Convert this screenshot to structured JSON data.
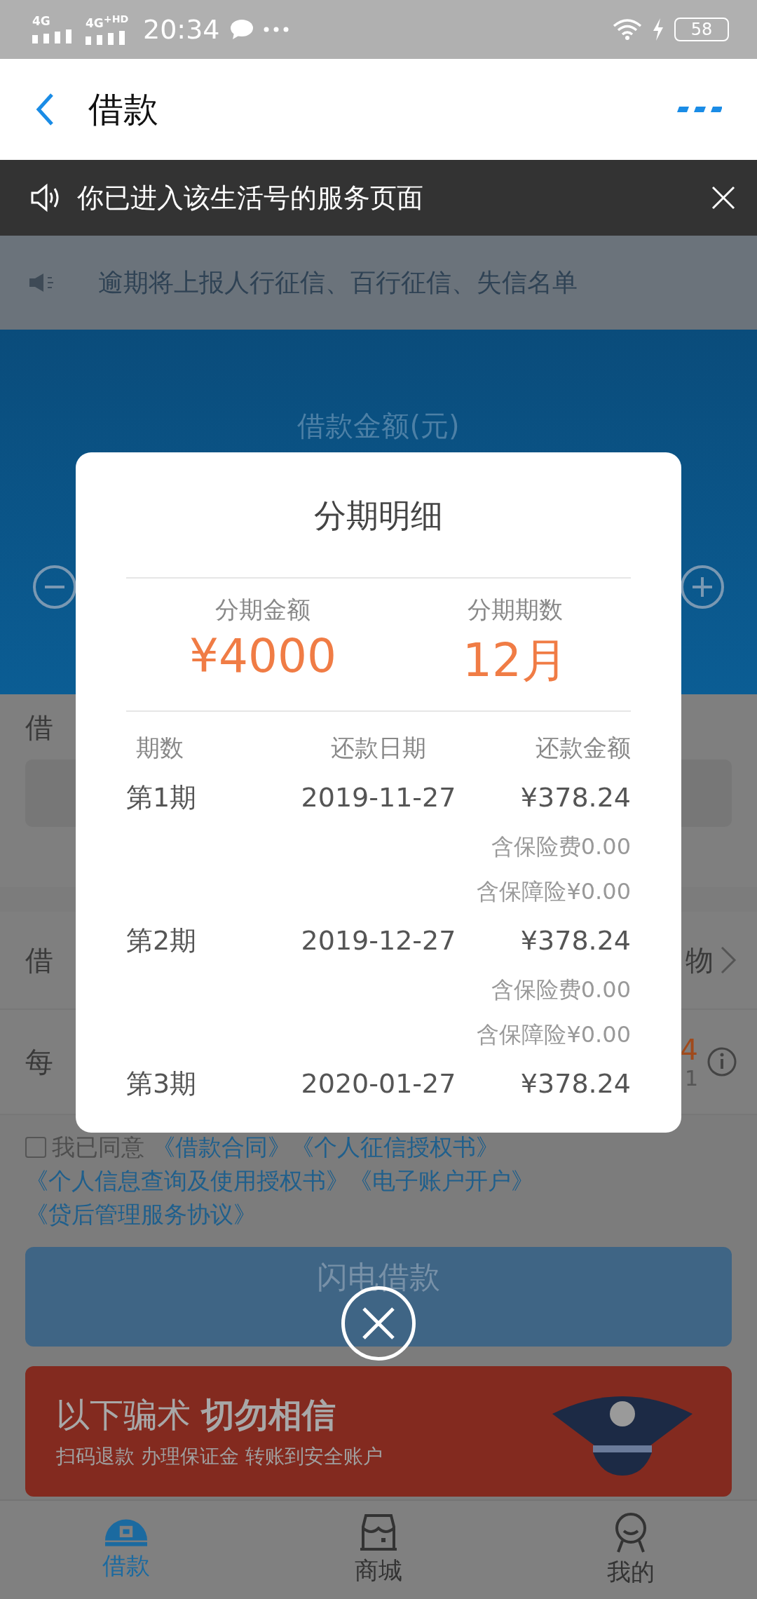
{
  "status_bar": {
    "networks": [
      "4G",
      "4G$^{+HD}$"
    ],
    "time": "20:34",
    "battery": "58"
  },
  "header": {
    "title": "借款"
  },
  "service_notice": {
    "text": "你已进入该生活号的服务页面"
  },
  "warning_strip": {
    "text": "逾期将上报人行征信、百行征信、失信名单"
  },
  "amount_panel": {
    "label": "借款金额(元)"
  },
  "form_rows": [
    {
      "kind": "input",
      "label": "借"
    },
    {
      "kind": "select",
      "label": "借",
      "value": "物"
    },
    {
      "kind": "info",
      "label": "每",
      "value": "4",
      "subvalue": "1"
    }
  ],
  "agreement": {
    "checked": false,
    "prefix": "我已同意",
    "links": [
      "《借款合同》",
      "《个人征信授权书》",
      "《个人信息查询及使用授权书》",
      "《电子账户开户》",
      "《贷后管理服务协议》"
    ]
  },
  "submit_button": {
    "label": "闪电借款"
  },
  "fraud_banner": {
    "title": "以下骗术 **切勿相信**",
    "subtitle": "扫码退款 办理保证金 转账到安全账户"
  },
  "tab_bar": [
    {
      "label": "借款",
      "selected": true
    },
    {
      "label": "商城",
      "selected": false
    },
    {
      "label": "我的",
      "selected": false
    }
  ],
  "installment_dialog": {
    "title": "分期明细",
    "summary": [
      {
        "label": "分期金额",
        "value": "¥4000"
      },
      {
        "label": "分期期数",
        "value": "12月"
      }
    ],
    "columns": [
      "期数",
      "还款日期",
      "还款金额"
    ],
    "rows": [
      {
        "period": "第1期",
        "date": "2019-11-27",
        "amount": "¥378.24",
        "notes": [
          "含保险费0.00",
          "含保障险¥0.00"
        ]
      },
      {
        "period": "第2期",
        "date": "2019-12-27",
        "amount": "¥378.24",
        "notes": [
          "含保险费0.00",
          "含保障险¥0.00"
        ]
      },
      {
        "period": "第3期",
        "date": "2020-01-27",
        "amount": "¥378.24",
        "notes": []
      }
    ]
  }
}
